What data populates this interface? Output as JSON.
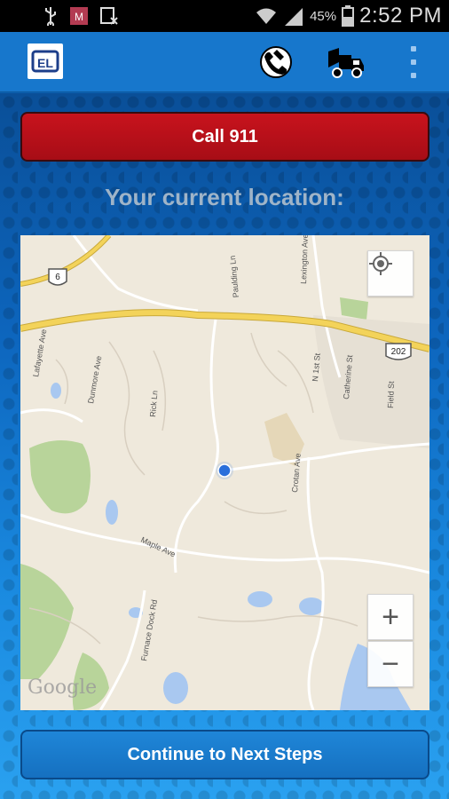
{
  "status_bar": {
    "battery": "45%",
    "time": "2:52 PM",
    "icons": [
      "usb-icon",
      "gmail-icon",
      "download-icon",
      "wifi-icon",
      "signal-icon",
      "battery-icon"
    ]
  },
  "app_bar": {
    "logo_icon": "app-logo-icon",
    "actions": [
      "phone-icon",
      "tow-truck-icon",
      "overflow-menu-icon"
    ]
  },
  "main": {
    "call_button": "Call 911",
    "location_label": "Your current location:",
    "continue_button": "Continue to Next Steps"
  },
  "map": {
    "attribution": "Google",
    "zoom_in": "+",
    "zoom_out": "−",
    "route_shields": [
      "6",
      "202"
    ],
    "street_labels": [
      "Lafayette Ave",
      "Dunmore Ave",
      "Rick Ln",
      "Paulding Ln",
      "Lexington Ave",
      "N 1st St",
      "Catherine St",
      "Field St",
      "Crotan Ave",
      "Maple Ave",
      "Furnace Dock Rd"
    ]
  },
  "colors": {
    "call_button": "#b5101a",
    "app_bar": "#1777cc",
    "location_dot": "#2a6fdb",
    "highway": "#f3d35a"
  }
}
